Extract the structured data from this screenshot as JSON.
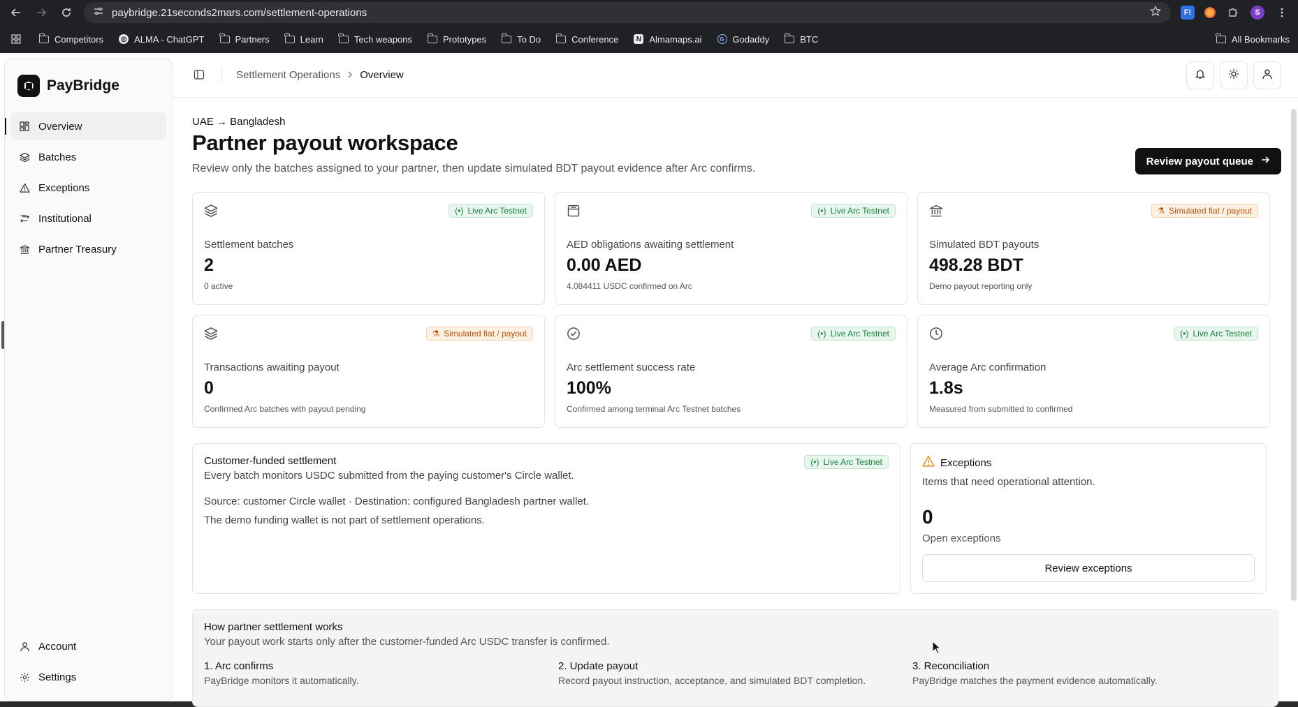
{
  "browser": {
    "url": "paybridge.21seconds2mars.com/settlement-operations",
    "bookmarks": [
      "Competitors",
      "ALMA - ChatGPT",
      "Partners",
      "Learn",
      "Tech weapons",
      "Prototypes",
      "To Do",
      "Conference",
      "Almamaps.ai",
      "Godaddy",
      "BTC"
    ],
    "all_bookmarks": "All Bookmarks",
    "profile_initial": "S",
    "ext_label": "F!"
  },
  "app": {
    "name": "PayBridge"
  },
  "sidebar": {
    "items": [
      {
        "label": "Overview",
        "icon": "grid-icon"
      },
      {
        "label": "Batches",
        "icon": "layers-icon"
      },
      {
        "label": "Exceptions",
        "icon": "warning-icon"
      },
      {
        "label": "Institutional",
        "icon": "route-icon"
      },
      {
        "label": "Partner Treasury",
        "icon": "bank-icon"
      }
    ],
    "bottom": [
      {
        "label": "Account",
        "icon": "user-icon"
      },
      {
        "label": "Settings",
        "icon": "gear-icon"
      }
    ]
  },
  "breadcrumb": {
    "parent": "Settlement Operations",
    "current": "Overview"
  },
  "header": {
    "route": "UAE → Bangladesh",
    "title": "Partner payout workspace",
    "subtitle": "Review only the batches assigned to your partner, then update simulated BDT payout evidence after Arc confirms.",
    "cta": "Review payout queue"
  },
  "cards": [
    {
      "label": "Settlement batches",
      "value": "2",
      "note": "0 active",
      "badge": "Live Arc Testnet"
    },
    {
      "label": "AED obligations awaiting settlement",
      "value": "0.00 AED",
      "note": "4.084411 USDC confirmed on Arc",
      "badge": "Live Arc Testnet"
    },
    {
      "label": "Simulated BDT payouts",
      "value": "498.28 BDT",
      "note": "Demo payout reporting only",
      "badge": "Simulated fiat / payout"
    },
    {
      "label": "Transactions awaiting payout",
      "value": "0",
      "note": "Confirmed Arc batches with payout pending",
      "badge": "Simulated fiat / payout"
    },
    {
      "label": "Arc settlement success rate",
      "value": "100%",
      "note": "Confirmed among terminal Arc Testnet batches",
      "badge": "Live Arc Testnet"
    },
    {
      "label": "Average Arc confirmation",
      "value": "1.8s",
      "note": "Measured from submitted to confirmed",
      "badge": "Live Arc Testnet"
    }
  ],
  "funded": {
    "title": "Customer-funded settlement",
    "badge": "Live Arc Testnet",
    "line1": "Every batch monitors USDC submitted from the paying customer's Circle wallet.",
    "line2": "Source: customer Circle wallet · Destination: configured Bangladesh partner wallet.",
    "line3": "The demo funding wallet is not part of settlement operations."
  },
  "exceptions": {
    "title": "Exceptions",
    "subtitle": "Items that need operational attention.",
    "count": "0",
    "count_label": "Open exceptions",
    "button": "Review exceptions"
  },
  "how": {
    "title": "How partner settlement works",
    "subtitle": "Your payout work starts only after the customer-funded Arc USDC transfer is confirmed.",
    "steps": [
      {
        "title": "1. Arc confirms",
        "text": "PayBridge monitors it automatically."
      },
      {
        "title": "2. Update payout",
        "text": "Record payout instruction, acceptance, and simulated BDT completion."
      },
      {
        "title": "3. Reconciliation",
        "text": "PayBridge matches the payment evidence automatically."
      }
    ]
  }
}
